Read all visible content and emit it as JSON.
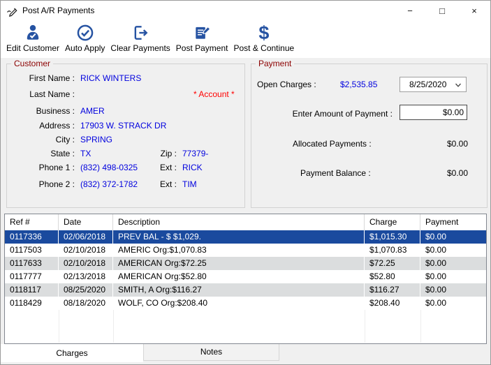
{
  "window": {
    "title": "Post A/R Payments",
    "controls": {
      "minimize": "−",
      "maximize": "□",
      "close": "×"
    }
  },
  "toolbar": {
    "items": [
      {
        "label": "Edit Customer",
        "icon": "person-check-icon"
      },
      {
        "label": "Auto Apply",
        "icon": "circle-check-icon"
      },
      {
        "label": "Clear Payments",
        "icon": "exit-arrow-icon"
      },
      {
        "label": "Post Payment",
        "icon": "document-pencil-icon"
      },
      {
        "label": "Post & Continue",
        "icon": "dollar-icon",
        "glyph": "$"
      }
    ]
  },
  "customer": {
    "title": "Customer",
    "account_flag": "* Account *",
    "fields": {
      "first_name": {
        "label": "First Name :",
        "value": "RICK WINTERS"
      },
      "last_name": {
        "label": "Last Name :",
        "value": ""
      },
      "business": {
        "label": "Business :",
        "value": "AMER"
      },
      "address": {
        "label": "Address :",
        "value": "17903 W. STRACK DR"
      },
      "city": {
        "label": "City :",
        "value": "SPRING"
      },
      "state": {
        "label": "State :",
        "value": "TX"
      },
      "zip": {
        "label": "Zip :",
        "value": "77379-"
      },
      "phone1": {
        "label": "Phone 1 :",
        "value": "(832) 498-0325"
      },
      "ext1": {
        "label": "Ext :",
        "value": "RICK"
      },
      "phone2": {
        "label": "Phone 2 :",
        "value": "(832) 372-1782"
      },
      "ext2": {
        "label": "Ext :",
        "value": "TIM"
      }
    }
  },
  "payment": {
    "title": "Payment",
    "open_charges": {
      "label": "Open Charges :",
      "value": "$2,535.85"
    },
    "date_select": {
      "value": "8/25/2020"
    },
    "enter_amount": {
      "label": "Enter Amount of Payment :",
      "value": "$0.00"
    },
    "allocated": {
      "label": "Allocated Payments :",
      "value": "$0.00"
    },
    "balance": {
      "label": "Payment Balance :",
      "value": "$0.00"
    }
  },
  "table": {
    "columns": [
      "Ref #",
      "Date",
      "Description",
      "Charge",
      "Payment"
    ],
    "rows": [
      {
        "ref": "0117336",
        "date": "02/06/2018",
        "description": "PREV BAL - $ $1,029.",
        "charge": "$1,015.30",
        "payment": "$0.00",
        "selected": true
      },
      {
        "ref": "0117503",
        "date": "02/10/2018",
        "description": "AMERIC Org:$1,070.83",
        "charge": "$1,070.83",
        "payment": "$0.00",
        "selected": false
      },
      {
        "ref": "0117633",
        "date": "02/10/2018",
        "description": "AMERICAN Org:$72.25",
        "charge": "$72.25",
        "payment": "$0.00",
        "selected": false
      },
      {
        "ref": "0117777",
        "date": "02/13/2018",
        "description": "AMERICAN Org:$52.80",
        "charge": "$52.80",
        "payment": "$0.00",
        "selected": false
      },
      {
        "ref": "0118117",
        "date": "08/25/2020",
        "description": "SMITH, A Org:$116.27",
        "charge": "$116.27",
        "payment": "$0.00",
        "selected": false
      },
      {
        "ref": "0118429",
        "date": "08/18/2020",
        "description": "WOLF, CO Org:$208.40",
        "charge": "$208.40",
        "payment": "$0.00",
        "selected": false
      }
    ]
  },
  "tabs": [
    {
      "label": "Charges",
      "active": true
    },
    {
      "label": "Notes",
      "active": false
    }
  ],
  "colors": {
    "accent_blue": "#2653A2",
    "value_blue": "#0000DE",
    "group_title_red": "#8B0000",
    "flag_red": "#FF0000",
    "selected_row_blue": "#1A4A9E",
    "alt_row_gray": "#DBDDDE"
  }
}
